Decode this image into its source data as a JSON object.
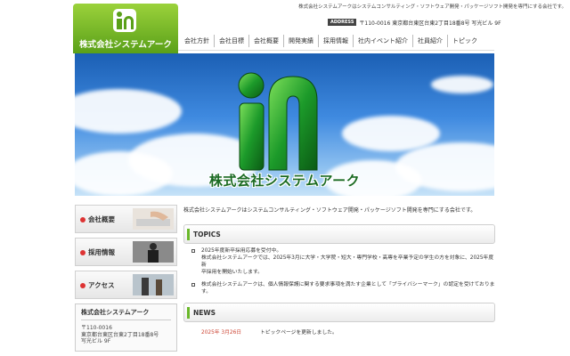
{
  "header": {
    "tagline": "株式会社システムアークはシステムコンサルティング・ソフトウェア開発・パッケージソフト開発を専門にする会社です。",
    "logo_text": "株式会社システムアーク",
    "address_label": "ADDRESS",
    "address": "〒110-0016 東京都台東区台東2丁目18番8号 写光ビル 9F"
  },
  "nav": [
    "会社方針",
    "会社目標",
    "会社概要",
    "開発実績",
    "採用情報",
    "社内イベント紹介",
    "社員紹介",
    "トピック"
  ],
  "hero": {
    "title": "株式会社システムアーク"
  },
  "sidebar": {
    "buttons": [
      "会社概要",
      "採用情報",
      "アクセス"
    ],
    "company_box": {
      "name": "株式会社システムアーク",
      "lines": [
        "〒110-0016",
        "東京都台東区台東2丁目18番8号",
        "写光ビル 9F"
      ]
    }
  },
  "main": {
    "intro": "株式会社システムアークはシステムコンサルティング・ソフトウェア開発・パッケージソフト開発を専門にする会社です。",
    "topics_title": "TOPICS",
    "topics": [
      {
        "line1": "2025年度新卒採用応募を受付中。",
        "line2": "株式会社システムアークでは、2025年3月に大学・大学院・短大・専門学校・高専を卒業予定の学生の方を対象に、2025年度新",
        "line3": "卒採用を開始いたします。"
      },
      {
        "line1": "株式会社システムアークは、個人情報保護に関する要求事項を満たす企業として「プライバシーマーク」の認定を受けておりま",
        "line2": "す。"
      }
    ],
    "news_title": "NEWS",
    "news": [
      {
        "date": "2025年 3月26日",
        "text": "トピックページを更新しました。"
      }
    ]
  },
  "colors": {
    "brand_green": "#5aa019",
    "accent_red": "#d33",
    "sky_blue": "#3f8ae0"
  }
}
